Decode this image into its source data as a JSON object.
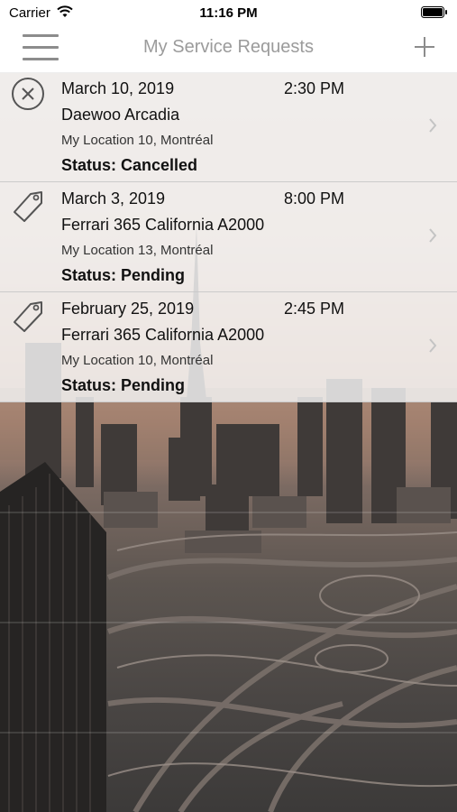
{
  "status_bar": {
    "carrier": "Carrier",
    "time": "11:16 PM"
  },
  "nav": {
    "title": "My Service Requests",
    "menu_icon": "hamburger-menu-icon",
    "add_icon": "plus-icon"
  },
  "requests": [
    {
      "icon": "cancel-circle-icon",
      "date": "March 10, 2019",
      "time": "2:30 PM",
      "vehicle": "Daewoo Arcadia",
      "location": "My Location 10, Montréal",
      "status": "Status: Cancelled"
    },
    {
      "icon": "tag-icon",
      "date": "March 3, 2019",
      "time": "8:00 PM",
      "vehicle": "Ferrari 365 California A2000",
      "location": "My Location 13, Montréal",
      "status": "Status: Pending"
    },
    {
      "icon": "tag-icon",
      "date": "February 25, 2019",
      "time": "2:45 PM",
      "vehicle": "Ferrari 365 California A2000",
      "location": "My Location 10, Montréal",
      "status": "Status: Pending"
    }
  ],
  "colors": {
    "nav_title": "#9b9b9b",
    "icon_gray": "#8c8c8c",
    "row_background": "#f0f0f0"
  }
}
